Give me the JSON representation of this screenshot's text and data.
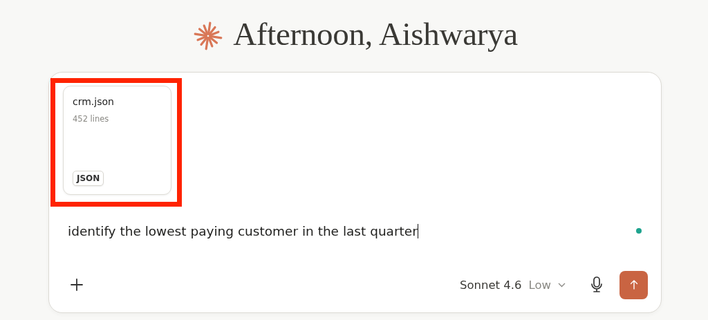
{
  "greeting": {
    "text": "Afternoon, Aishwarya"
  },
  "composer": {
    "attachments": [
      {
        "name": "crm.json",
        "meta": "452 lines",
        "badge": "JSON",
        "highlighted": true
      }
    ],
    "prompt": {
      "value": "identify the lowest paying customer in the last quarter",
      "focused": true
    },
    "model": {
      "name": "Sonnet 4.6",
      "effort": "Low"
    }
  }
}
